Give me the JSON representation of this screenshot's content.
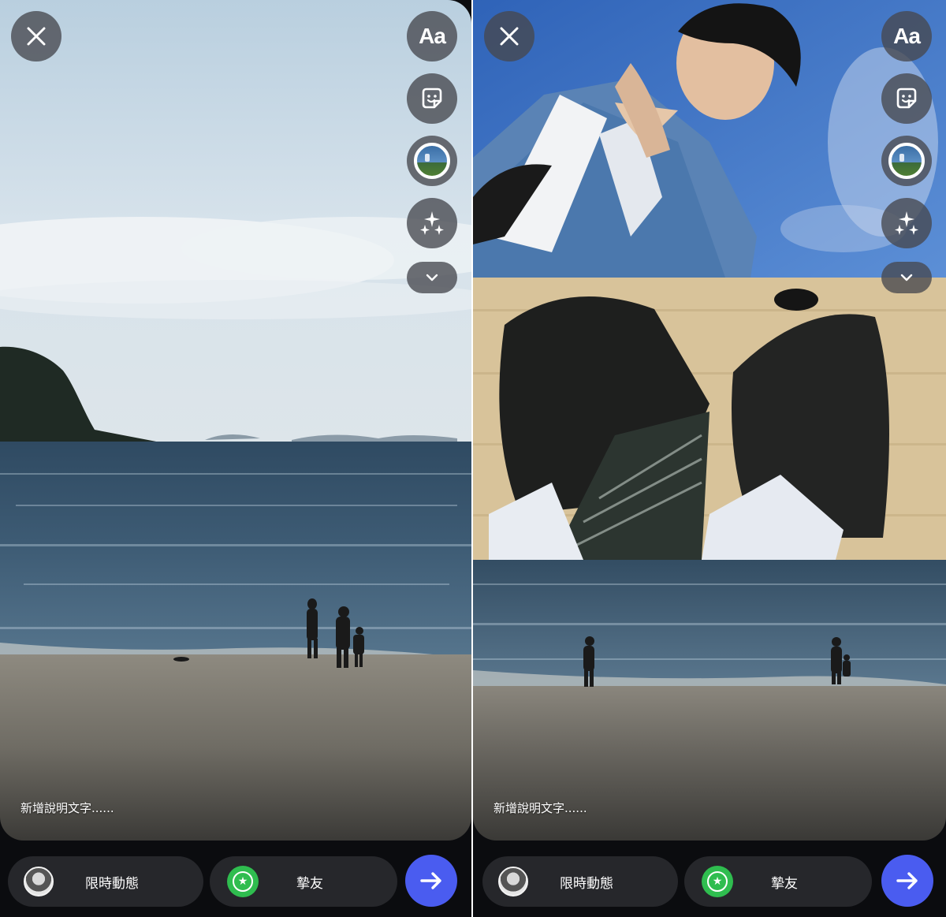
{
  "screens": [
    {
      "caption_placeholder": "新增說明文字......",
      "tools": {
        "text_label": "Aa"
      },
      "bottom": {
        "story_label": "限時動態",
        "friends_label": "摯友",
        "friends_icon": "star-icon"
      }
    },
    {
      "caption_placeholder": "新增說明文字......",
      "tools": {
        "text_label": "Aa"
      },
      "bottom": {
        "story_label": "限時動態",
        "friends_label": "摯友",
        "friends_icon": "star-icon"
      }
    }
  ],
  "colors": {
    "send_button": "#4a5cf0",
    "close_friends": "#2fbd4f",
    "pill_background": "#26272b"
  }
}
